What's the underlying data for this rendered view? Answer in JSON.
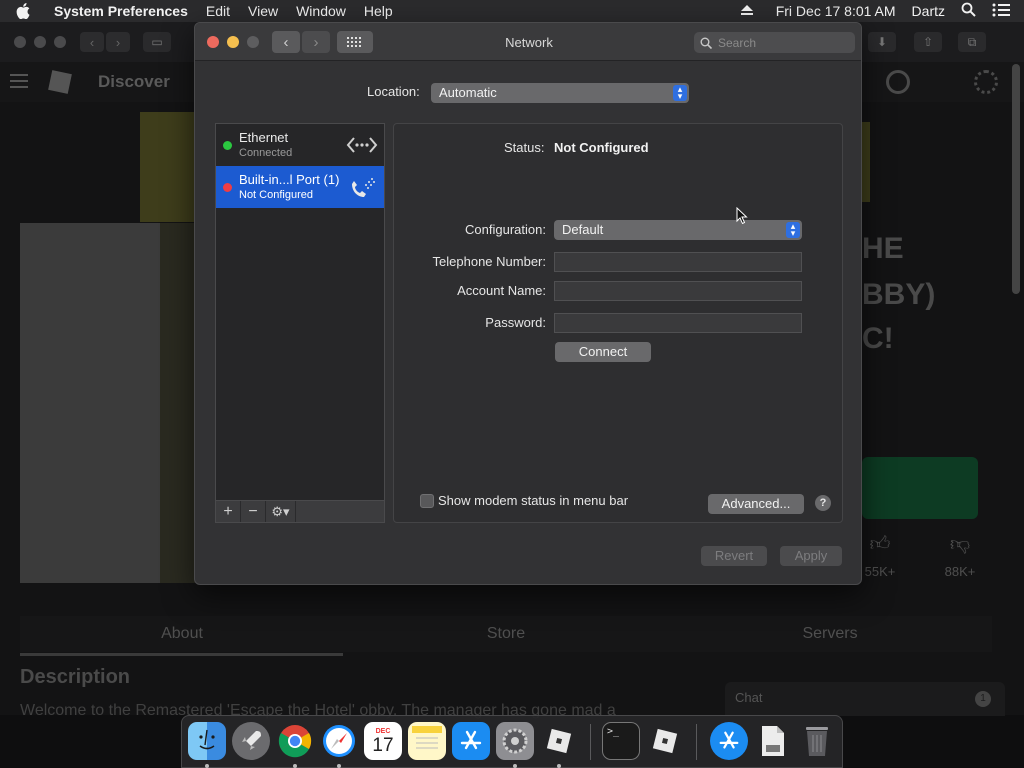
{
  "menubar": {
    "app_name": "System Preferences",
    "items": [
      "Edit",
      "View",
      "Window",
      "Help"
    ],
    "clock": "Fri Dec 17  8:01 AM",
    "user": "Dartz"
  },
  "browser": {
    "site_label": "Discover",
    "game_title_lines": [
      "HE",
      "BBY)",
      "C!"
    ],
    "votes_up": "55K+",
    "votes_down": "88K+",
    "tabs": [
      "About",
      "Store",
      "Servers"
    ],
    "description_title": "Description",
    "description_text": "Welcome to the Remastered 'Escape the Hotel' obby. The manager has gone mad a",
    "chat_label": "Chat",
    "chat_badge": "1"
  },
  "window": {
    "title": "Network",
    "search_placeholder": "Search",
    "location_label": "Location:",
    "location_value": "Automatic",
    "services": [
      {
        "name": "Ethernet",
        "state": "Connected",
        "status_color": "#2bc840",
        "icon": "ethernet-icon",
        "selected": false
      },
      {
        "name": "Built-in...l Port (1)",
        "state": "Not Configured",
        "status_color": "#ee3d44",
        "icon": "phone-modem-icon",
        "selected": true
      }
    ],
    "list_buttons": {
      "add": "+",
      "remove": "−",
      "gear": "⚙︎▾"
    },
    "detail": {
      "status_label": "Status:",
      "status_value": "Not Configured",
      "configuration_label": "Configuration:",
      "configuration_value": "Default",
      "telephone_label": "Telephone Number:",
      "telephone_value": "",
      "account_label": "Account Name:",
      "account_value": "",
      "password_label": "Password:",
      "password_value": "",
      "connect_label": "Connect",
      "show_modem_label": "Show modem status in menu bar",
      "advanced_label": "Advanced...",
      "help_label": "?"
    },
    "revert_label": "Revert",
    "apply_label": "Apply"
  },
  "dock": {
    "calendar_month": "DEC",
    "calendar_day": "17",
    "items": [
      "Finder",
      "Launchpad",
      "Chrome",
      "Safari",
      "Calendar",
      "Notes",
      "App Store",
      "System Preferences",
      "Roblox",
      "Terminal",
      "Roblox Studio",
      "App Store Downloads",
      "File",
      "Trash"
    ]
  },
  "colors": {
    "accent": "#1c5bd1",
    "connected": "#2bc840",
    "not_configured": "#ee3d44"
  }
}
